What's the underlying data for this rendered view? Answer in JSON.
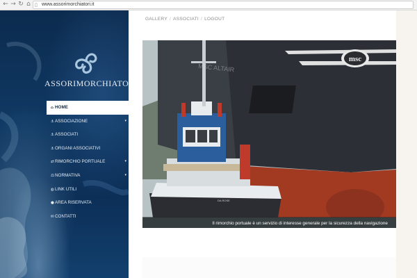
{
  "browser": {
    "url": "www.assorimorchiatori.it",
    "back_icon": "back-arrow-icon",
    "forward_icon": "forward-arrow-icon",
    "reload_icon": "reload-icon",
    "home_icon": "home-icon",
    "page_icon": "page-icon"
  },
  "site": {
    "name": "ASSORIMORCHIATORI",
    "logo_icon": "triskelion-wave-logo",
    "logo_color": "#a9c7df"
  },
  "top_nav": [
    "GALLERY",
    "ASSOCIATI",
    "LOGOUT"
  ],
  "menu": [
    {
      "label": "HOME",
      "icon": "home-icon",
      "glyph": "⌂",
      "active": true,
      "submenu": false
    },
    {
      "label": "ASSOCIAZIONE",
      "icon": "anchor-icon",
      "glyph": "⚓",
      "active": false,
      "submenu": true
    },
    {
      "label": "ASSOCIATI",
      "icon": "anchor-icon",
      "glyph": "⚓",
      "active": false,
      "submenu": false
    },
    {
      "label": "ORGANI ASSOCIATIVI",
      "icon": "anchor-icon",
      "glyph": "⚓",
      "active": false,
      "submenu": false
    },
    {
      "label": "RIMORCHIO PORTUALE",
      "icon": "exchange-icon",
      "glyph": "⇄",
      "active": false,
      "submenu": true
    },
    {
      "label": "NORMATIVA",
      "icon": "gavel-icon",
      "glyph": "⚖",
      "active": false,
      "submenu": true
    },
    {
      "label": "LINK UTILI",
      "icon": "globe-icon",
      "glyph": "◍",
      "active": false,
      "submenu": false
    },
    {
      "label": "AREA RISERVATA",
      "icon": "lock-icon",
      "glyph": "●",
      "active": false,
      "submenu": false
    },
    {
      "label": "CONTATTI",
      "icon": "envelope-icon",
      "glyph": "✉",
      "active": false,
      "submenu": false
    }
  ],
  "hero": {
    "caption": "Il rimorchio portuale è un servizio di interesse generale per la sicurezza della navigazione",
    "ship_name": "MSC ALTAIR",
    "funnel_logo": "msc",
    "tug_name": "DA ROSE",
    "colors": {
      "hull": "#2c2f35",
      "bottom_paint": "#a23a22",
      "tug_blue": "#2b5e9c",
      "tug_white": "#e8ecef"
    }
  },
  "colors": {
    "sidebar": "#0f3862",
    "active_menu_bg": "#ffffff",
    "text_light": "#e6edf5"
  }
}
